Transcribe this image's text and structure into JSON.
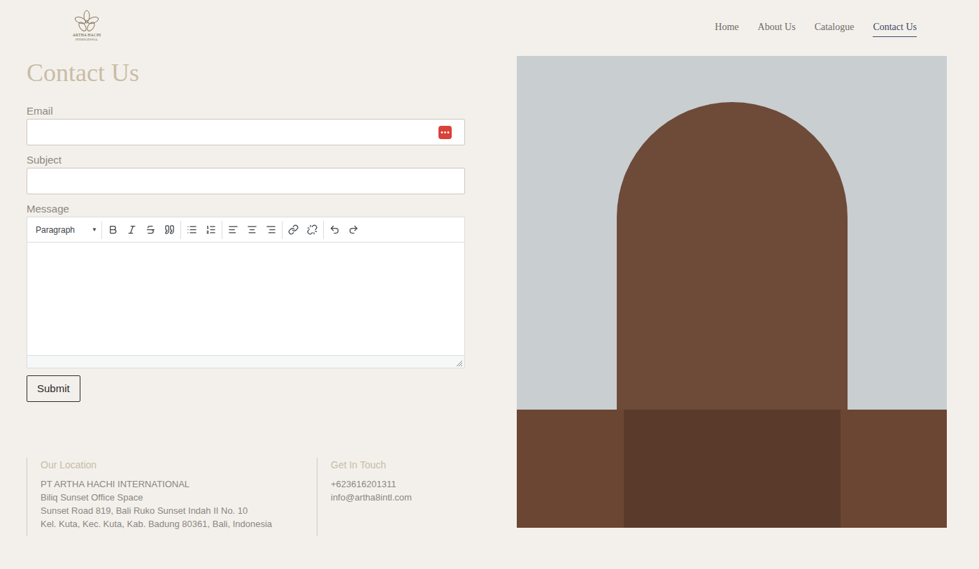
{
  "logo": {
    "name": "ARTHA HACHI",
    "subtitle": "INTERNATIONAL"
  },
  "nav": [
    {
      "label": "Home",
      "selected": false
    },
    {
      "label": "About Us",
      "selected": false
    },
    {
      "label": "Catalogue",
      "selected": false
    },
    {
      "label": "Contact Us",
      "selected": true
    }
  ],
  "page_title": "Contact Us",
  "form": {
    "fields": [
      {
        "label": "Email",
        "value": "",
        "password_manager": true
      },
      {
        "label": "Subject",
        "value": "",
        "password_manager": false
      }
    ],
    "message": {
      "label": "Message",
      "format": "Paragraph",
      "dropdown_arrow": "▼",
      "value": ""
    },
    "submit": "Submit"
  },
  "footer": [
    {
      "heading": "Our Location",
      "lines": [
        "PT ARTHA HACHI INTERNATIONAL",
        "Biliq Sunset Office Space",
        "Sunset Road 819, Bali Ruko Sunset Indah II No. 10",
        "Kel. Kuta, Kec. Kuta, Kab. Badung 80361, Bali, Indonesia"
      ]
    },
    {
      "heading": "Get In Touch",
      "lines": [
        "+623616201311",
        "info@artha8intl.com"
      ]
    }
  ]
}
